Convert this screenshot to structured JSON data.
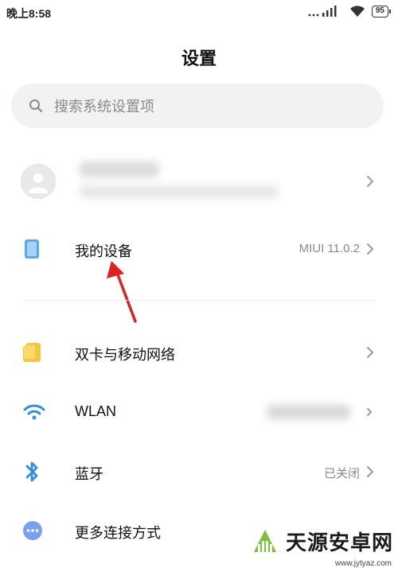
{
  "status_bar": {
    "time": "晚上8:58",
    "battery": "95"
  },
  "header": {
    "title": "设置"
  },
  "search": {
    "placeholder": "搜索系统设置项"
  },
  "account": {
    "name": "",
    "subtitle": ""
  },
  "items": [
    {
      "label": "我的设备",
      "value": "MIUI 11.0.2",
      "icon": "tablet-icon",
      "color": "#5aa9ef"
    },
    {
      "label": "双卡与移动网络",
      "value": "",
      "icon": "sim-card-icon",
      "color": "#f7c53b"
    },
    {
      "label": "WLAN",
      "value": "",
      "icon": "wifi-icon",
      "color": "#2f8de4"
    },
    {
      "label": "蓝牙",
      "value": "已关闭",
      "icon": "bluetooth-icon",
      "color": "#2f8de4"
    },
    {
      "label": "更多连接方式",
      "value": "",
      "icon": "more-dots-icon",
      "color": "#7b9ff0"
    }
  ],
  "watermark": {
    "text": "天源安卓网",
    "url": "www.jytyaz.com"
  },
  "colors": {
    "annotation_arrow": "#e02020",
    "chevron": "#9a9a9a"
  }
}
